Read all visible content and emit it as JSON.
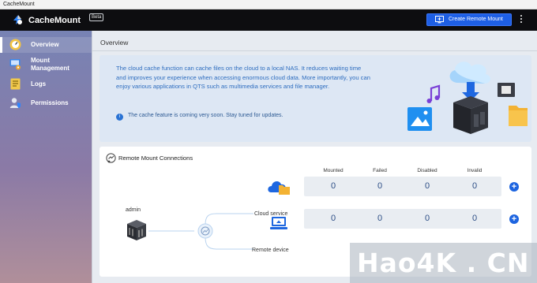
{
  "window": {
    "title": "CacheMount"
  },
  "header": {
    "app_name": "CacheMount",
    "badge": "Beta",
    "create_button": "Create Remote Mount",
    "create_icon": "monitor-plus-icon",
    "more_icon": "vertical-dots-icon"
  },
  "sidebar": {
    "items": [
      {
        "label": "Overview",
        "icon": "dashboard-gauge-icon",
        "active": true
      },
      {
        "label": "Mount Management",
        "line1": "Mount",
        "line2": "Management",
        "icon": "mount-gear-icon",
        "active": false
      },
      {
        "label": "Logs",
        "icon": "logs-list-icon",
        "active": false
      },
      {
        "label": "Permissions",
        "icon": "user-shield-icon",
        "active": false
      }
    ]
  },
  "main": {
    "title": "Overview",
    "banner": {
      "text": "The cloud cache function can cache files on the cloud to a local NAS. It reduces waiting time and improves your experience when accessing enormous cloud data. More importantly, you can enjoy various applications in QTS such as multimedia services and file manager.",
      "note": "The cache feature is coming very soon. Stay tuned for updates.",
      "note_icon": "info-icon"
    },
    "connections": {
      "title": "Remote Mount Connections",
      "nas_label": "admin",
      "columns": [
        "Mounted",
        "Failed",
        "Disabled",
        "Invalid"
      ],
      "rows": [
        {
          "label": "Cloud service",
          "icon": "cloud-folder-icon",
          "values": [
            "0",
            "0",
            "0",
            "0"
          ]
        },
        {
          "label": "Remote device",
          "icon": "remote-laptop-icon",
          "values": [
            "0",
            "0",
            "0",
            "0"
          ]
        }
      ]
    }
  },
  "watermark": "Hao4K . CN",
  "colors": {
    "header_bg": "#0d0d10",
    "accent": "#1e5fe5",
    "banner_text": "#2e6dbf",
    "stat_value": "#2d4e86"
  }
}
